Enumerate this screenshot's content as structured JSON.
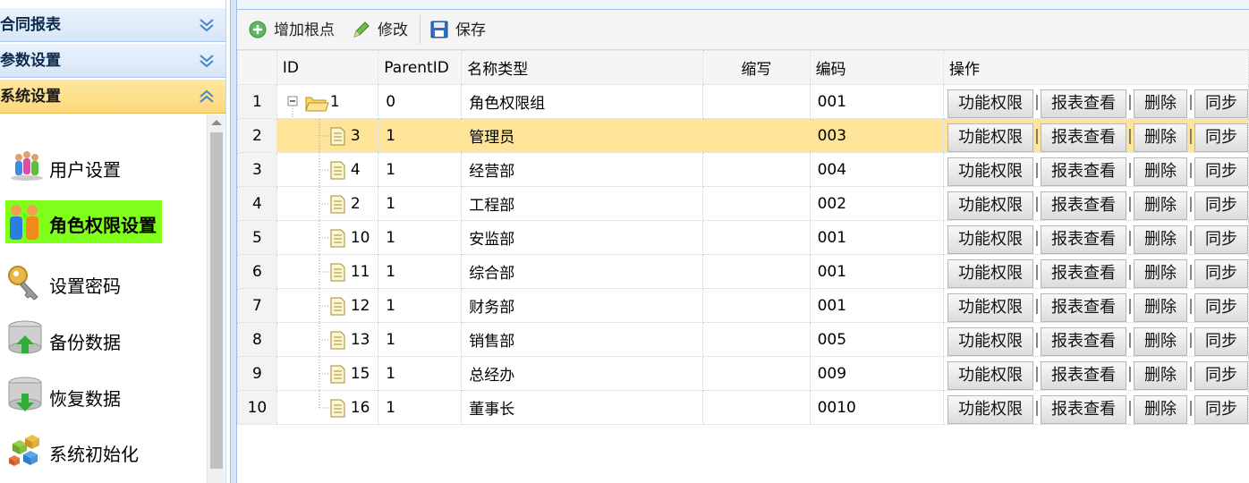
{
  "accordion": {
    "panels": [
      {
        "title": "合同报表"
      },
      {
        "title": "参数设置"
      },
      {
        "title": "系统设置"
      }
    ],
    "items": [
      {
        "label": "用户设置",
        "icon": "users-icon"
      },
      {
        "label": "角色权限设置",
        "icon": "role-users-icon"
      },
      {
        "label": "设置密码",
        "icon": "key-icon"
      },
      {
        "label": "备份数据",
        "icon": "database-backup-icon"
      },
      {
        "label": "恢复数据",
        "icon": "database-restore-icon"
      },
      {
        "label": "系统初始化",
        "icon": "cubes-icon"
      }
    ]
  },
  "toolbar": {
    "add_root": "增加根点",
    "edit": "修改",
    "save": "保存"
  },
  "grid": {
    "columns": {
      "id": "ID",
      "parent": "ParentID",
      "name": "名称类型",
      "abbr": "缩写",
      "code": "编码",
      "ops": "操作"
    },
    "actions": {
      "perm": "功能权限",
      "report": "报表查看",
      "delete": "删除",
      "sync": "同步"
    },
    "rows": [
      {
        "rn": "1",
        "id": "1",
        "parent": "0",
        "name": "角色权限组",
        "abbr": "",
        "code": "001"
      },
      {
        "rn": "2",
        "id": "3",
        "parent": "1",
        "name": "管理员",
        "abbr": "",
        "code": "003"
      },
      {
        "rn": "3",
        "id": "4",
        "parent": "1",
        "name": "经营部",
        "abbr": "",
        "code": "004"
      },
      {
        "rn": "4",
        "id": "2",
        "parent": "1",
        "name": "工程部",
        "abbr": "",
        "code": "002"
      },
      {
        "rn": "5",
        "id": "10",
        "parent": "1",
        "name": "安监部",
        "abbr": "",
        "code": "001"
      },
      {
        "rn": "6",
        "id": "11",
        "parent": "1",
        "name": "综合部",
        "abbr": "",
        "code": "001"
      },
      {
        "rn": "7",
        "id": "12",
        "parent": "1",
        "name": "财务部",
        "abbr": "",
        "code": "001"
      },
      {
        "rn": "8",
        "id": "13",
        "parent": "1",
        "name": "销售部",
        "abbr": "",
        "code": "005"
      },
      {
        "rn": "9",
        "id": "15",
        "parent": "1",
        "name": "总经办",
        "abbr": "",
        "code": "009"
      },
      {
        "rn": "10",
        "id": "16",
        "parent": "1",
        "name": "董事长",
        "abbr": "",
        "code": "0010"
      }
    ]
  }
}
